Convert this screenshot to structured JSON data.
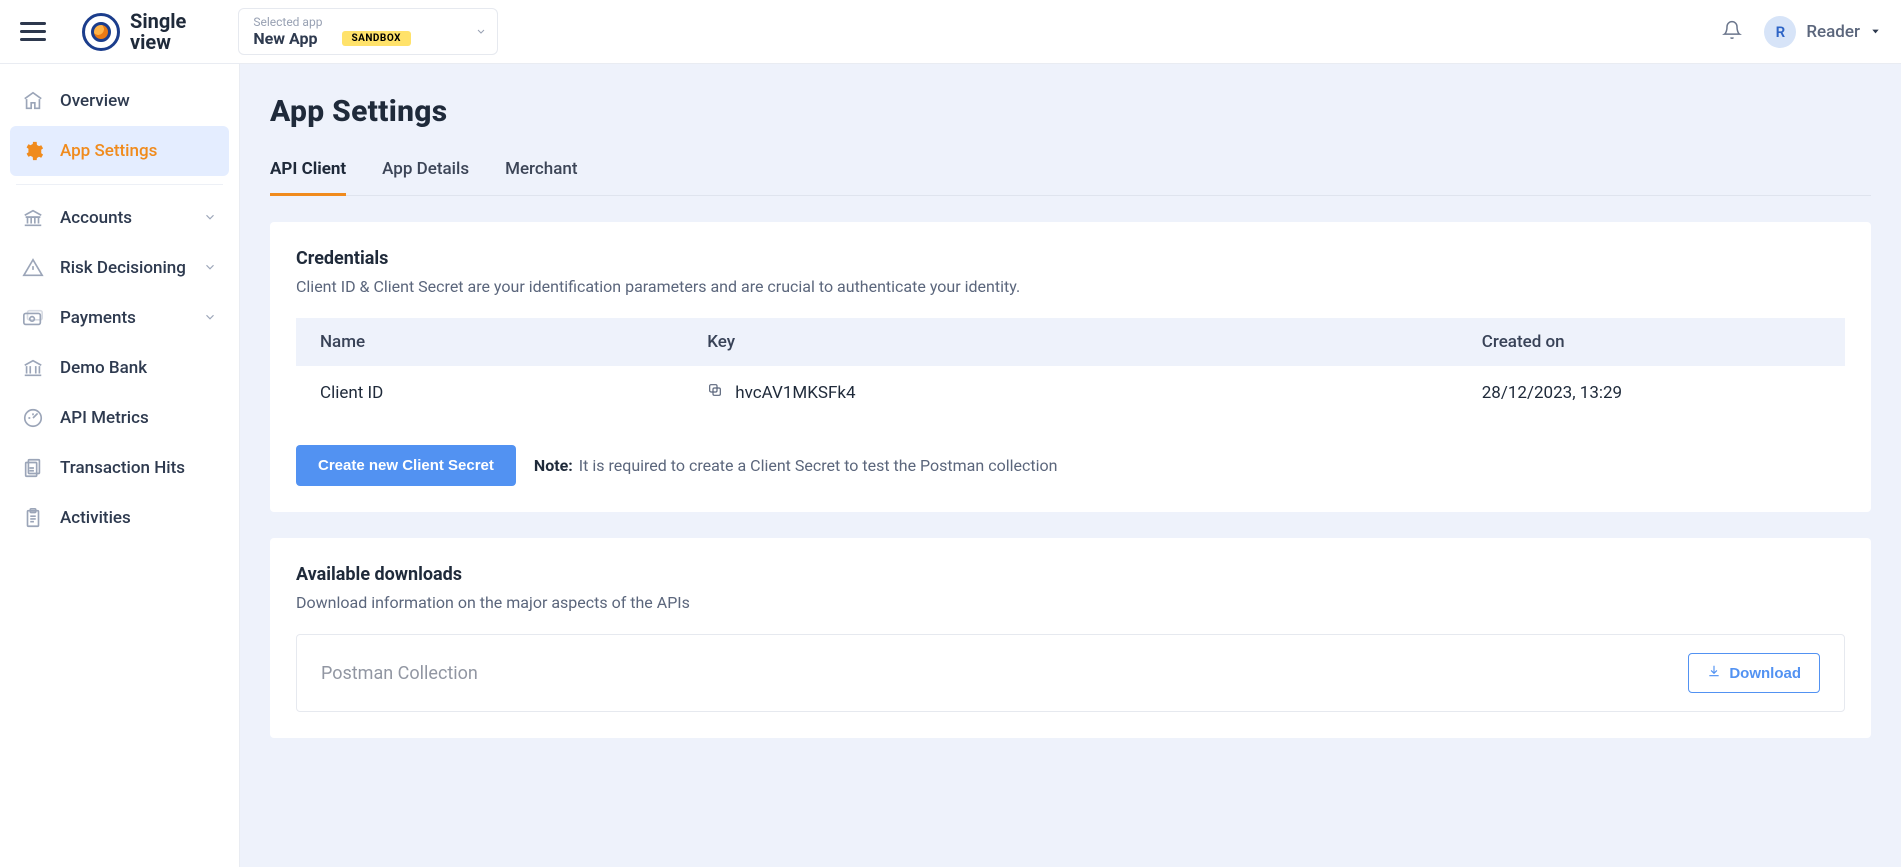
{
  "header": {
    "logo": {
      "line1": "Single",
      "line2": "view"
    },
    "app_selector": {
      "label": "Selected app",
      "value": "New App",
      "badge": "SANDBOX"
    },
    "user": {
      "initial": "R",
      "name": "Reader"
    }
  },
  "sidebar": {
    "items": [
      {
        "label": "Overview"
      },
      {
        "label": "App Settings"
      },
      {
        "label": "Accounts"
      },
      {
        "label": "Risk Decisioning"
      },
      {
        "label": "Payments"
      },
      {
        "label": "Demo Bank"
      },
      {
        "label": "API Metrics"
      },
      {
        "label": "Transaction Hits"
      },
      {
        "label": "Activities"
      }
    ]
  },
  "page": {
    "title": "App Settings",
    "tabs": [
      {
        "label": "API Client"
      },
      {
        "label": "App Details"
      },
      {
        "label": "Merchant"
      }
    ],
    "credentials": {
      "title": "Credentials",
      "desc": "Client ID & Client Secret are your identification parameters and are crucial to authenticate your identity.",
      "columns": {
        "name": "Name",
        "key": "Key",
        "created": "Created on"
      },
      "rows": [
        {
          "name": "Client ID",
          "key": "hvcAV1MKSFk4",
          "created": "28/12/2023, 13:29"
        }
      ],
      "cta": "Create new Client Secret",
      "note_label": "Note:",
      "note_text": "It is required to create a Client Secret to test the Postman collection"
    },
    "downloads": {
      "title": "Available downloads",
      "desc": "Download information on the major aspects of the APIs",
      "items": [
        {
          "name": "Postman Collection",
          "action": "Download"
        }
      ]
    }
  }
}
